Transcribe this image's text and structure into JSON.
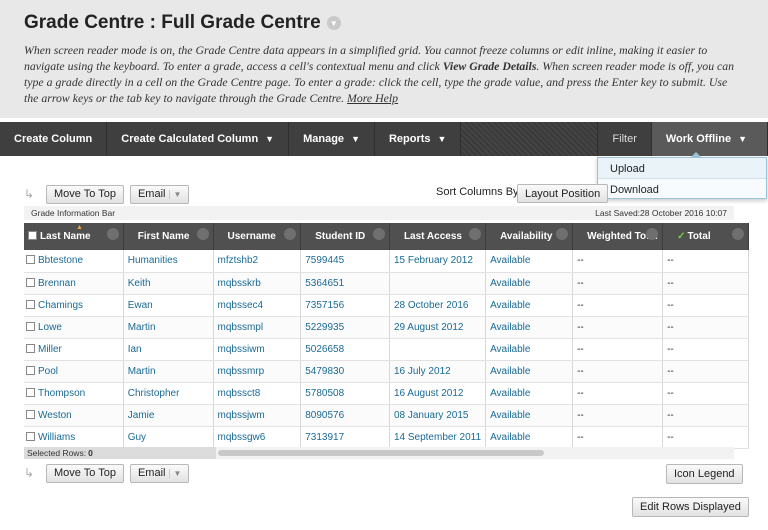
{
  "header": {
    "title": "Grade Centre : Full Grade Centre",
    "instructions_part1": "When screen reader mode is on, the Grade Centre data appears in a simplified grid. You cannot freeze columns or edit inline, making it easier to navigate using the keyboard. To enter a grade, access a cell's contextual menu and click ",
    "instructions_bold": "View Grade Details",
    "instructions_part2": ". When screen reader mode is off, you can type a grade directly in a cell on the Grade Centre page. To enter a grade: click the cell, type the grade value, and press the Enter key to submit. Use the arrow keys or the tab key to navigate through the Grade Centre. ",
    "more_help": "More Help"
  },
  "action_bar": {
    "create_column": "Create Column",
    "create_calculated_column": "Create Calculated Column",
    "manage": "Manage",
    "reports": "Reports",
    "filter": "Filter",
    "work_offline": "Work Offline"
  },
  "work_offline_menu": {
    "items": [
      "Upload",
      "Download"
    ]
  },
  "toolbar_top": {
    "move_to_top": "Move To Top",
    "email": "Email",
    "sort_columns_label": "Sort Columns By:",
    "sort_columns_value": "Layout Position"
  },
  "info_bar": {
    "label": "Grade Information Bar",
    "last_saved": "Last Saved:28 October 2016 10:07"
  },
  "grid": {
    "columns": [
      "Last Name",
      "First Name",
      "Username",
      "Student ID",
      "Last Access",
      "Availability",
      "Weighted Total",
      "Total"
    ],
    "rows": [
      {
        "last": "Bbtestone",
        "first": "Humanities",
        "user": "mfztshb2",
        "id": "7599445",
        "access": "15 February 2012",
        "avail": "Available",
        "weighted": "--",
        "total": "--"
      },
      {
        "last": "Brennan",
        "first": "Keith",
        "user": "mqbsskrb",
        "id": "5364651",
        "access": "",
        "avail": "Available",
        "weighted": "--",
        "total": "--"
      },
      {
        "last": "Chamings",
        "first": "Ewan",
        "user": "mqbssec4",
        "id": "7357156",
        "access": "28 October 2016",
        "avail": "Available",
        "weighted": "--",
        "total": "--"
      },
      {
        "last": "Lowe",
        "first": "Martin",
        "user": "mqbssmpl",
        "id": "5229935",
        "access": "29 August 2012",
        "avail": "Available",
        "weighted": "--",
        "total": "--"
      },
      {
        "last": "Miller",
        "first": "Ian",
        "user": "mqbssiwm",
        "id": "5026658",
        "access": "",
        "avail": "Available",
        "weighted": "--",
        "total": "--"
      },
      {
        "last": "Pool",
        "first": "Martin",
        "user": "mqbssmrp",
        "id": "5479830",
        "access": "16 July 2012",
        "avail": "Available",
        "weighted": "--",
        "total": "--"
      },
      {
        "last": "Thompson",
        "first": "Christopher",
        "user": "mqbssct8",
        "id": "5780508",
        "access": "16 August 2012",
        "avail": "Available",
        "weighted": "--",
        "total": "--"
      },
      {
        "last": "Weston",
        "first": "Jamie",
        "user": "mqbssjwm",
        "id": "8090576",
        "access": "08 January 2015",
        "avail": "Available",
        "weighted": "--",
        "total": "--"
      },
      {
        "last": "Williams",
        "first": "Guy",
        "user": "mqbssgw6",
        "id": "7313917",
        "access": "14 September 2011",
        "avail": "Available",
        "weighted": "--",
        "total": "--"
      }
    ]
  },
  "footer": {
    "selected_rows_label": "Selected Rows:",
    "selected_rows_count": "0",
    "move_to_top": "Move To Top",
    "email": "Email",
    "icon_legend": "Icon Legend",
    "edit_rows_displayed": "Edit Rows Displayed"
  },
  "colors": {
    "header_bg": "#e8e8e8",
    "action_bar_bg": "#3f3f3f",
    "grid_header_bg": "#505050",
    "link_color": "#1a6a95",
    "dropdown_bg": "#eaf3f8"
  }
}
